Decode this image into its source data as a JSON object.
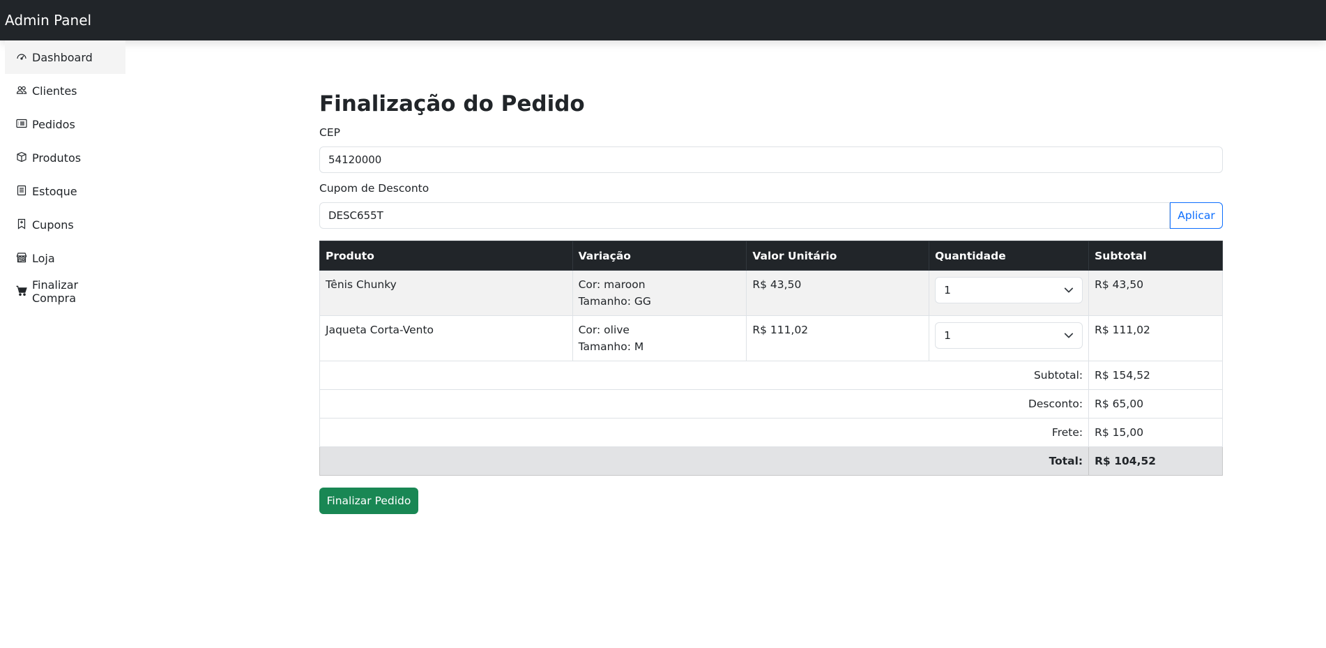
{
  "app": {
    "title": "Admin Panel"
  },
  "sidebar": {
    "items": [
      {
        "label": "Dashboard",
        "icon": "speedometer-icon"
      },
      {
        "label": "Clientes",
        "icon": "people-icon"
      },
      {
        "label": "Pedidos",
        "icon": "card-list-icon"
      },
      {
        "label": "Produtos",
        "icon": "box-icon"
      },
      {
        "label": "Estoque",
        "icon": "journal-list-icon"
      },
      {
        "label": "Cupons",
        "icon": "bookmark-icon"
      },
      {
        "label": "Loja",
        "icon": "shop-icon"
      },
      {
        "label": "Finalizar Compra",
        "icon": "cart-icon"
      }
    ]
  },
  "page": {
    "title": "Finalização do Pedido",
    "cep_label": "CEP",
    "cep_value": "54120000",
    "coupon_label": "Cupom de Desconto",
    "coupon_value": "DESC655T",
    "apply_label": "Aplicar"
  },
  "table": {
    "headers": [
      "Produto",
      "Variação",
      "Valor Unitário",
      "Quantidade",
      "Subtotal"
    ],
    "rows": [
      {
        "product": "Tênis Chunky",
        "color": "Cor: maroon",
        "size": "Tamanho: GG",
        "unit_price": "R$ 43,50",
        "qty": "1",
        "subtotal": "R$ 43,50"
      },
      {
        "product": "Jaqueta Corta-Vento",
        "color": "Cor: olive",
        "size": "Tamanho: M",
        "unit_price": "R$ 111,02",
        "qty": "1",
        "subtotal": "R$ 111,02"
      }
    ],
    "summary": {
      "subtotal_label": "Subtotal:",
      "subtotal_value": "R$ 154,52",
      "discount_label": "Desconto:",
      "discount_value": "R$ 65,00",
      "shipping_label": "Frete:",
      "shipping_value": "R$ 15,00",
      "total_label": "Total:",
      "total_value": "R$ 104,52"
    }
  },
  "actions": {
    "finish_label": "Finalizar Pedido"
  },
  "colors": {
    "topbar": "#212529",
    "primary": "#0d6efd",
    "success": "#198754",
    "table_header": "#212529",
    "total_row": "#e2e3e5"
  }
}
